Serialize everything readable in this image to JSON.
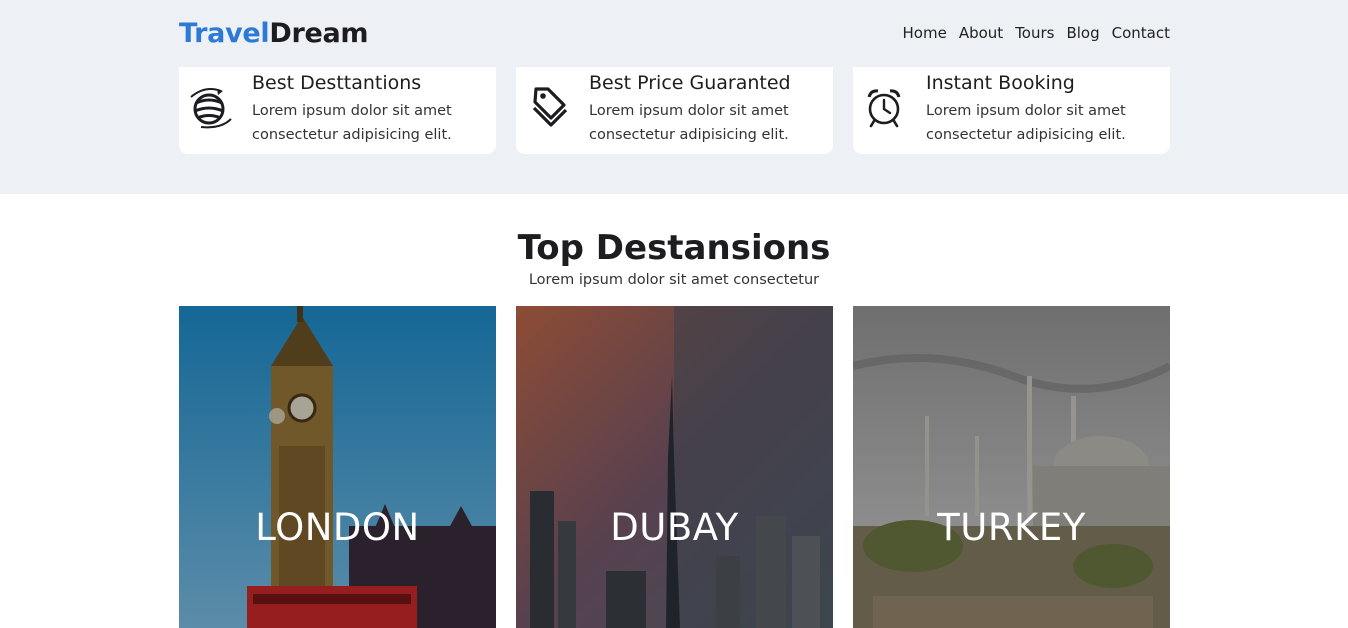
{
  "brand": {
    "part1": "Travel",
    "part2": "Dream"
  },
  "nav": {
    "items": [
      "Home",
      "About",
      "Tours",
      "Blog",
      "Contact"
    ]
  },
  "features": [
    {
      "icon": "globe-plane-icon",
      "title": "Best Desttantions",
      "desc": "Lorem ipsum dolor sit amet consectetur adipisicing elit."
    },
    {
      "icon": "price-tag-icon",
      "title": "Best Price Guaranted",
      "desc": "Lorem ipsum dolor sit amet consectetur adipisicing elit."
    },
    {
      "icon": "alarm-clock-icon",
      "title": "Instant Booking",
      "desc": "Lorem ipsum dolor sit amet consectetur adipisicing elit."
    }
  ],
  "section": {
    "title": "Top Destansions",
    "subtitle": "Lorem ipsum dolor sit amet consectetur"
  },
  "destinations": [
    {
      "name": "LONDON"
    },
    {
      "name": "DUBAY"
    },
    {
      "name": "TURKEY"
    }
  ],
  "colors": {
    "brand_blue": "#2d7ad6",
    "band_bg": "#edf1f5",
    "text_dark": "#1d1d1f"
  }
}
